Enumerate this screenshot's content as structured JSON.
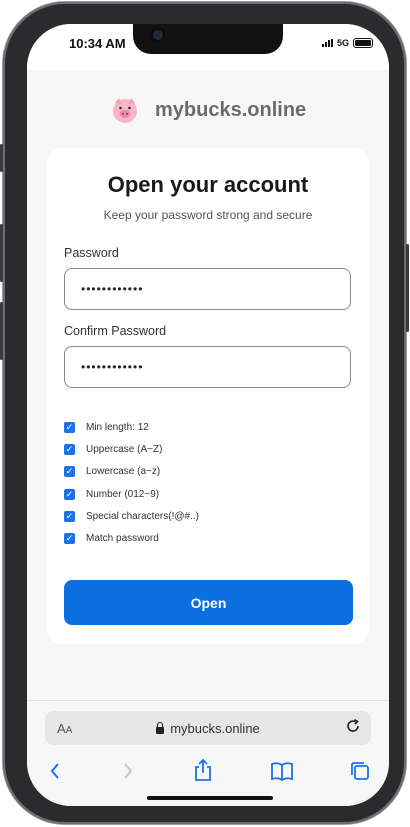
{
  "status": {
    "time": "10:34 AM",
    "network": "5G"
  },
  "brand": {
    "name": "mybucks.online",
    "icon": "pig-logo"
  },
  "card": {
    "title": "Open your account",
    "subtitle": "Keep your password strong and secure",
    "password": {
      "label": "Password",
      "value": "••••••••••••"
    },
    "confirm": {
      "label": "Confirm Password",
      "value": "••••••••••••"
    },
    "checks": [
      {
        "label": "Min length: 12",
        "checked": true
      },
      {
        "label": "Uppercase (A~Z)",
        "checked": true
      },
      {
        "label": "Lowercase (a~z)",
        "checked": true
      },
      {
        "label": "Number (012~9)",
        "checked": true
      },
      {
        "label": "Special characters(!@#..)",
        "checked": true
      },
      {
        "label": "Match password",
        "checked": true
      }
    ],
    "open_button": "Open"
  },
  "browser": {
    "aa_big": "A",
    "aa_small": "A",
    "url": "mybucks.online",
    "icons": [
      "back-icon",
      "forward-icon",
      "share-icon",
      "bookmarks-icon",
      "tabs-icon",
      "reload-icon",
      "lock-icon"
    ]
  },
  "colors": {
    "accent": "#0b6fe0",
    "checkbox": "#1a73e8",
    "brand_text": "#6b6b6b"
  }
}
